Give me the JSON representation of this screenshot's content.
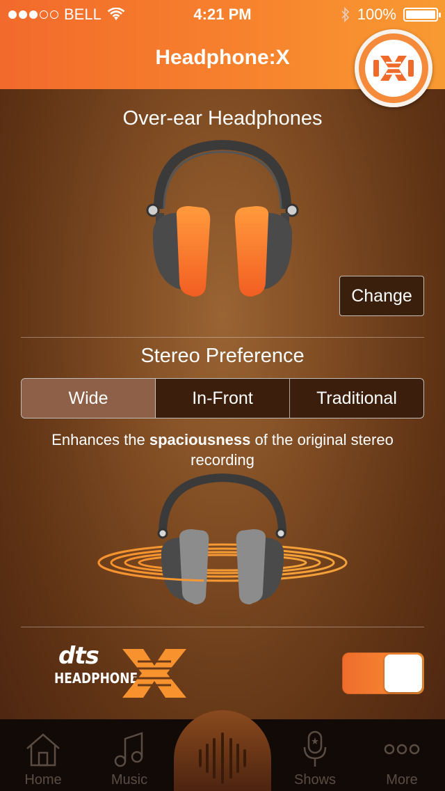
{
  "status_bar": {
    "carrier": "BELL",
    "time": "4:21 PM",
    "battery": "100%"
  },
  "header": {
    "title": "Headphone:X"
  },
  "headphone_section": {
    "title": "Over-ear Headphones",
    "change_label": "Change"
  },
  "stereo": {
    "title": "Stereo Preference",
    "options": [
      "Wide",
      "In-Front",
      "Traditional"
    ],
    "selected": "Wide",
    "desc_before": "Enhances the ",
    "desc_bold": "spaciousness",
    "desc_after": " of the original stereo recording"
  },
  "brand": {
    "dts_text": "dts",
    "headphone_text": "HEADPHONE",
    "toggle_on": true
  },
  "tabs": [
    {
      "label": "Home",
      "icon": "home-icon"
    },
    {
      "label": "Music",
      "icon": "music-note-icon"
    },
    {
      "label": "",
      "icon": "audio-wave-icon"
    },
    {
      "label": "Shows",
      "icon": "microphone-icon"
    },
    {
      "label": "More",
      "icon": "more-dots-icon"
    }
  ],
  "colors": {
    "accent": "#f7822d",
    "header_start": "#f26a2c",
    "background": "#7d4a22"
  }
}
